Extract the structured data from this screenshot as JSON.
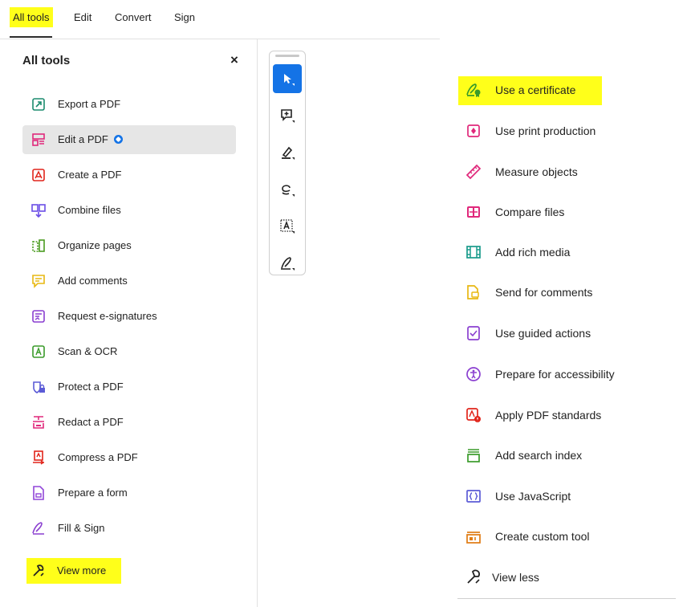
{
  "nav": {
    "tabs": [
      {
        "label": "All tools"
      },
      {
        "label": "Edit"
      },
      {
        "label": "Convert"
      },
      {
        "label": "Sign"
      }
    ]
  },
  "left_panel": {
    "title": "All tools",
    "close": "×",
    "tools": [
      {
        "label": "Export a PDF",
        "icon": "export-pdf-icon",
        "color": "#1c8c6e"
      },
      {
        "label": "Edit a PDF",
        "icon": "edit-pdf-icon",
        "color": "#e0287b"
      },
      {
        "label": "Create a PDF",
        "icon": "create-pdf-icon",
        "color": "#e1251b"
      },
      {
        "label": "Combine files",
        "icon": "combine-files-icon",
        "color": "#6b4ee6"
      },
      {
        "label": "Organize pages",
        "icon": "organize-pages-icon",
        "color": "#4a9b1f"
      },
      {
        "label": "Add comments",
        "icon": "add-comments-icon",
        "color": "#e8b812"
      },
      {
        "label": "Request e-signatures",
        "icon": "request-esign-icon",
        "color": "#8a3fd0"
      },
      {
        "label": "Scan & OCR",
        "icon": "scan-ocr-icon",
        "color": "#3a9b2a"
      },
      {
        "label": "Protect a PDF",
        "icon": "protect-pdf-icon",
        "color": "#5b5bd6"
      },
      {
        "label": "Redact a PDF",
        "icon": "redact-pdf-icon",
        "color": "#e0287b"
      },
      {
        "label": "Compress a PDF",
        "icon": "compress-pdf-icon",
        "color": "#e1251b"
      },
      {
        "label": "Prepare a form",
        "icon": "prepare-form-icon",
        "color": "#9146d9"
      },
      {
        "label": "Fill & Sign",
        "icon": "fill-sign-icon",
        "color": "#8a3fd0"
      }
    ],
    "view_more": "View more"
  },
  "toolbar": {
    "buttons": [
      "select-icon",
      "add-comment-icon",
      "highlight-icon",
      "draw-icon",
      "text-field-icon",
      "sign-icon"
    ]
  },
  "right_list": {
    "tools": [
      {
        "label": "Use a certificate",
        "icon": "certificate-icon",
        "color": "#3a9b2a"
      },
      {
        "label": "Use print production",
        "icon": "print-production-icon",
        "color": "#e0287b"
      },
      {
        "label": "Measure objects",
        "icon": "measure-icon",
        "color": "#e0287b"
      },
      {
        "label": "Compare files",
        "icon": "compare-files-icon",
        "color": "#e0287b"
      },
      {
        "label": "Add rich media",
        "icon": "rich-media-icon",
        "color": "#1a9b8c"
      },
      {
        "label": "Send for comments",
        "icon": "send-comments-icon",
        "color": "#e8b812"
      },
      {
        "label": "Use guided actions",
        "icon": "guided-actions-icon",
        "color": "#8a3fd0"
      },
      {
        "label": "Prepare for accessibility",
        "icon": "accessibility-icon",
        "color": "#8a3fd0"
      },
      {
        "label": "Apply PDF standards",
        "icon": "pdf-standards-icon",
        "color": "#e1251b"
      },
      {
        "label": "Add search index",
        "icon": "search-index-icon",
        "color": "#3a9b2a"
      },
      {
        "label": "Use JavaScript",
        "icon": "javascript-icon",
        "color": "#5b5bd6"
      },
      {
        "label": "Create custom tool",
        "icon": "custom-tool-icon",
        "color": "#e07b12"
      }
    ],
    "view_less": "View less"
  },
  "colors": {
    "highlight": "#ffff1a",
    "accent": "#1473e6",
    "selected_bg": "#e6e6e6"
  }
}
